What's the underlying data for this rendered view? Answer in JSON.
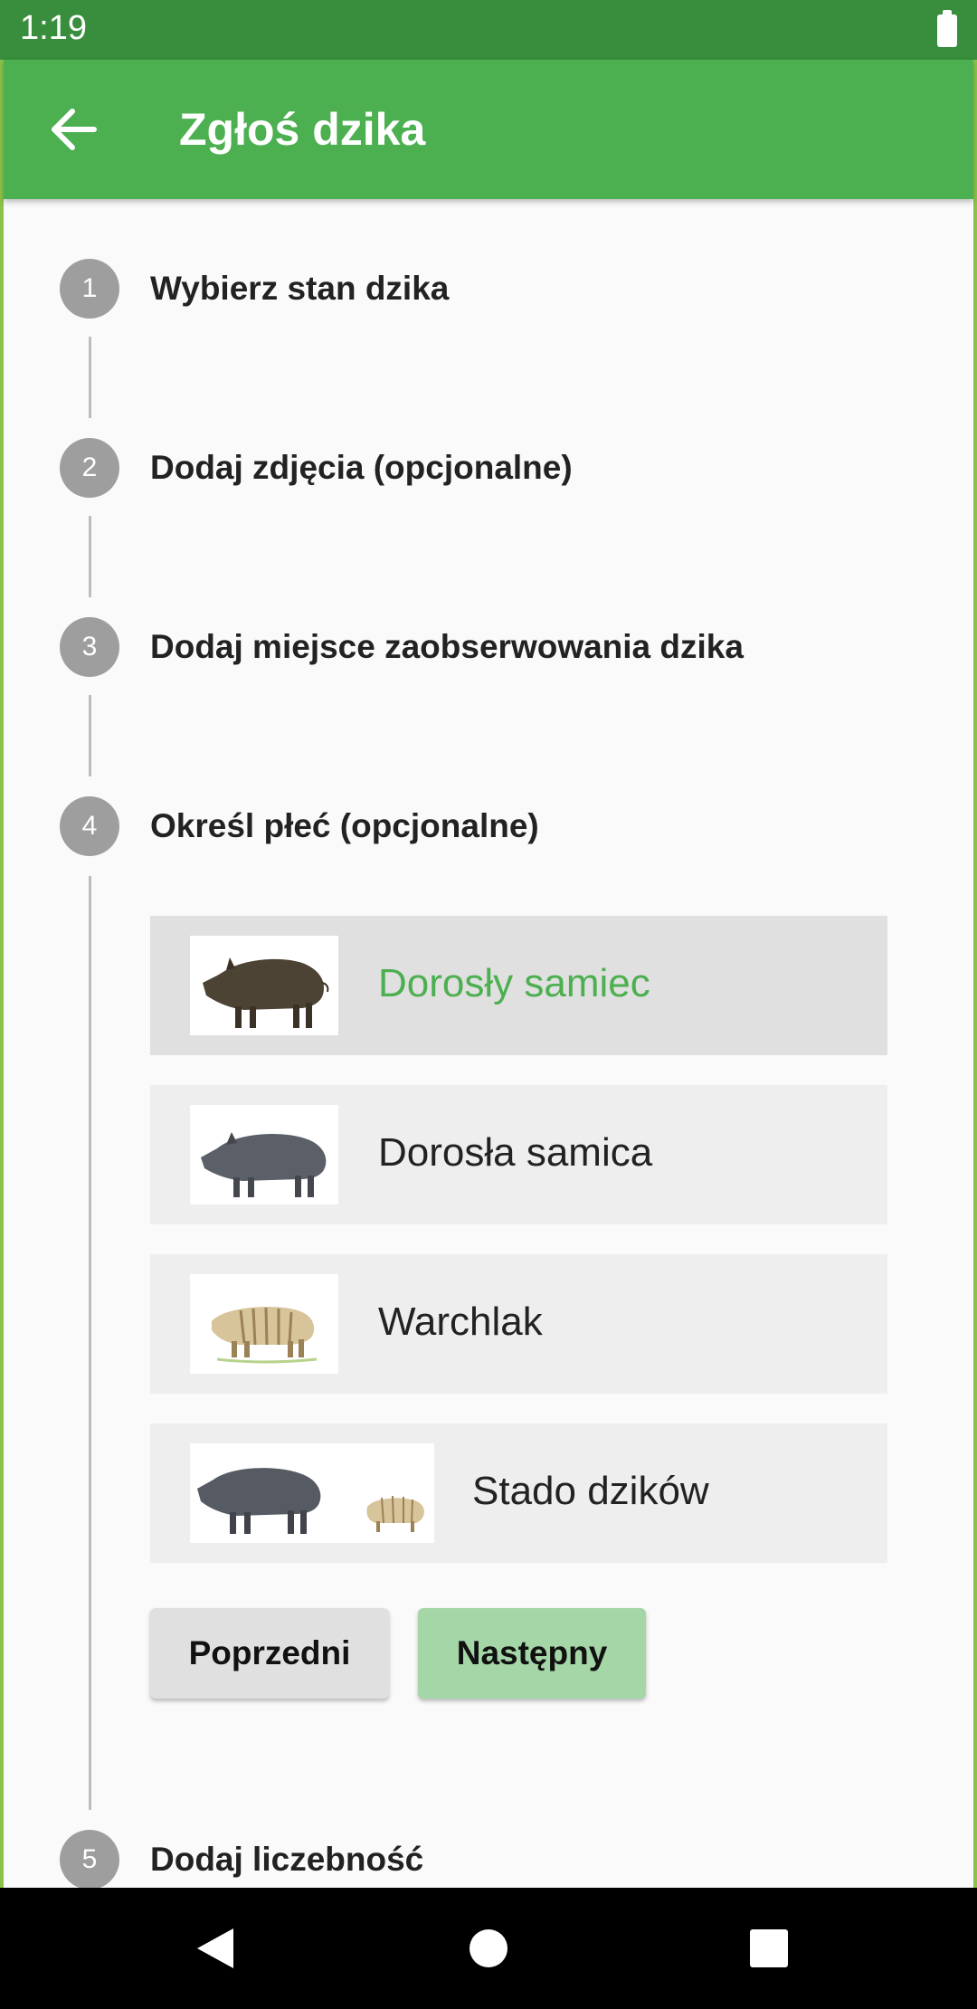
{
  "status_bar": {
    "time": "1:19"
  },
  "app_bar": {
    "title": "Zgłoś dzika"
  },
  "steps": [
    {
      "number": "1",
      "title": "Wybierz stan dzika"
    },
    {
      "number": "2",
      "title": "Dodaj zdjęcia (opcjonalne)"
    },
    {
      "number": "3",
      "title": "Dodaj miejsce zaobserwowania dzika"
    },
    {
      "number": "4",
      "title": "Określ płeć (opcjonalne)"
    },
    {
      "number": "5",
      "title": "Dodaj liczebność"
    }
  ],
  "options": [
    {
      "label": "Dorosły samiec",
      "image": "adult-boar-image",
      "selected": true
    },
    {
      "label": "Dorosła samica",
      "image": "adult-sow-image",
      "selected": false
    },
    {
      "label": "Warchlak",
      "image": "piglet-image",
      "selected": false
    },
    {
      "label": "Stado dzików",
      "image": "herd-image",
      "selected": false
    }
  ],
  "buttons": {
    "previous": "Poprzedni",
    "next": "Następny"
  },
  "colors": {
    "primary": "#4caf50",
    "primary_dark": "#388e3c",
    "selected_text": "#4caf50",
    "next_button": "#a5d6a7",
    "step_circle": "#9e9e9e"
  }
}
